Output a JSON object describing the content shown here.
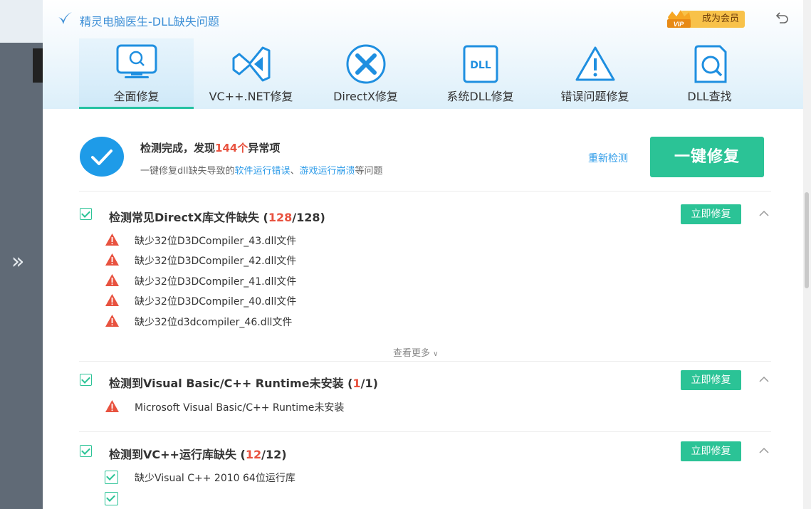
{
  "app": {
    "title": "精灵电脑医生-DLL缺失问题",
    "vip_label": "成为会员",
    "vip_badge": "VIP"
  },
  "tabs": [
    {
      "label": "全面修复",
      "icon": "monitor-search-icon",
      "active": true
    },
    {
      "label": "VC++.NET修复",
      "icon": "visual-studio-icon"
    },
    {
      "label": "DirectX修复",
      "icon": "directx-icon"
    },
    {
      "label": "系统DLL修复",
      "icon": "dll-file-icon"
    },
    {
      "label": "错误问题修复",
      "icon": "warning-triangle-icon"
    },
    {
      "label": "DLL查找",
      "icon": "dll-search-icon"
    }
  ],
  "status": {
    "title_prefix": "检测完成，发现",
    "count": "144个",
    "title_suffix": "异常项",
    "sub_prefix": "一键修复dll缺失导致的",
    "sub_link1": "软件运行错误",
    "sub_sep": "、",
    "sub_link2": "游戏运行崩溃",
    "sub_suffix": "等问题",
    "rescan": "重新检测",
    "fix_all": "一键修复"
  },
  "sections": [
    {
      "title": "检测常见DirectX库文件缺失 (",
      "found": "128",
      "total": "/128)",
      "fix": "立即修复",
      "items": [
        "缺少32位D3DCompiler_43.dll文件",
        "缺少32位D3DCompiler_42.dll文件",
        "缺少32位D3DCompiler_41.dll文件",
        "缺少32位D3DCompiler_40.dll文件",
        "缺少32位d3dcompiler_46.dll文件"
      ],
      "more": "查看更多"
    },
    {
      "title": "检测到Visual Basic/C++ Runtime未安装 (",
      "found": "1",
      "total": "/1)",
      "fix": "立即修复",
      "items": [
        "Microsoft Visual Basic/C++ Runtime未安装"
      ]
    },
    {
      "title": "检测到VC++运行库缺失 (",
      "found": "12",
      "total": "/12)",
      "fix": "立即修复",
      "items": [
        "缺少Visual C++ 2010 64位运行库"
      ]
    }
  ],
  "colors": {
    "accent_green": "#2bc396",
    "brand_blue": "#2d9be8",
    "alert_red": "#e8523f"
  }
}
